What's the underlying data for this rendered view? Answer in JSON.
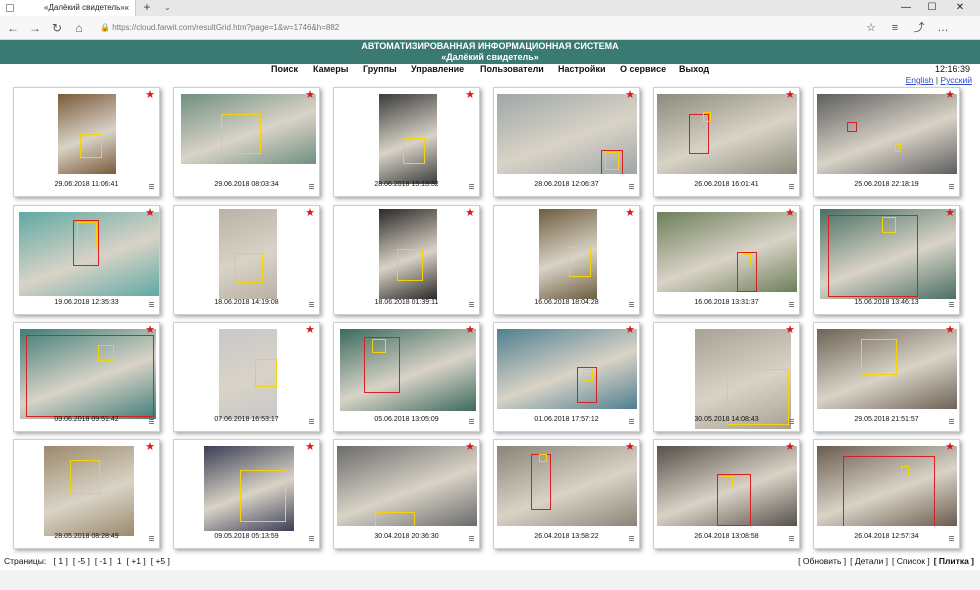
{
  "browser": {
    "tab_title": "«Далёкий свидетель»",
    "tab_close": "×",
    "new_tab": "+",
    "tab_dropdown": "⌄",
    "url": "https://cloud.farwit.com/resultGrid.htm?page=1&w=1746&h=882",
    "lock_icon": "🔒"
  },
  "header": {
    "line1": "АВТОМАТИЗИРОВАННАЯ ИНФОРМАЦИОННАЯ СИСТЕМА",
    "line2": "«Далёкий свидетель»",
    "clock": "12:16:39",
    "lang_en": "English",
    "lang_sep": "|",
    "lang_ru": "Русский"
  },
  "menu": [
    "Поиск",
    "Камеры",
    "Группы",
    "Управление",
    "Пользователи",
    "Настройки",
    "О сервисе",
    "Выход"
  ],
  "items": [
    {
      "ts": "29.06.2018 11:06:41",
      "scene": "#7a5a3a"
    },
    {
      "ts": "29.06.2018 08:03:34",
      "scene": "#6f8f7f"
    },
    {
      "ts": "28.06.2018 15:13:32",
      "scene": "#3b3b3b"
    },
    {
      "ts": "28.06.2018 12:06:37",
      "scene": "#9ea7a6"
    },
    {
      "ts": "26.06.2018 16:01:41",
      "scene": "#8b8b7d"
    },
    {
      "ts": "25.06.2018 22:18:19",
      "scene": "#5e5e5e"
    },
    {
      "ts": "19.06.2018 12:35:33",
      "scene": "#5fa9a3"
    },
    {
      "ts": "18.06.2018 14:19:08",
      "scene": "#b8b2a5"
    },
    {
      "ts": "18.06.2018 01:39:11",
      "scene": "#2c2826"
    },
    {
      "ts": "16.06.2018 18:04:28",
      "scene": "#6d5d3e"
    },
    {
      "ts": "16.06.2018 13:31:37",
      "scene": "#6c7f5a"
    },
    {
      "ts": "15.06.2018 13:46:13",
      "scene": "#4a6f63"
    },
    {
      "ts": "09.06.2018 09:51:42",
      "scene": "#3f7d77"
    },
    {
      "ts": "07.06.2018 16:53:17",
      "scene": "#c8c8c8"
    },
    {
      "ts": "05.06.2018 13:05:09",
      "scene": "#3b6a5e"
    },
    {
      "ts": "01.06.2018 17:57:12",
      "scene": "#4f7f8f"
    },
    {
      "ts": "30.05.2018 14:08:43",
      "scene": "#a8a095"
    },
    {
      "ts": "29.05.2018 21:51:57",
      "scene": "#6d6256"
    },
    {
      "ts": "28.05.2018 08:28:49",
      "scene": "#9b8a6c"
    },
    {
      "ts": "09.05.2018 05:13:59",
      "scene": "#3c3f54"
    },
    {
      "ts": "30.04.2018 20:36:30",
      "scene": "#6b6b6b"
    },
    {
      "ts": "26.04.2018 13:58:22",
      "scene": "#8a8377"
    },
    {
      "ts": "26.04.2018 13:08:58",
      "scene": "#56504a"
    },
    {
      "ts": "26.04.2018 12:57:34",
      "scene": "#6b5b4f"
    }
  ],
  "footer": {
    "pages_label": "Страницы:",
    "pages": [
      "[ 1 ]",
      "[ -5 ]",
      "[ -1 ]",
      "1",
      "[ +1 ]",
      "[ +5 ]"
    ],
    "views": [
      "[ Обновить ]",
      "[ Детали ]",
      "[ Список ]",
      "[ Плитка ]"
    ]
  },
  "icons": {
    "star": "★",
    "back": "←",
    "forward": "→",
    "reload": "↻",
    "home": "⌂",
    "favorites": "☆",
    "reading": "≡",
    "share": "⤴",
    "more": "…",
    "minimize": "—",
    "maximize": "☐",
    "close": "✕"
  }
}
